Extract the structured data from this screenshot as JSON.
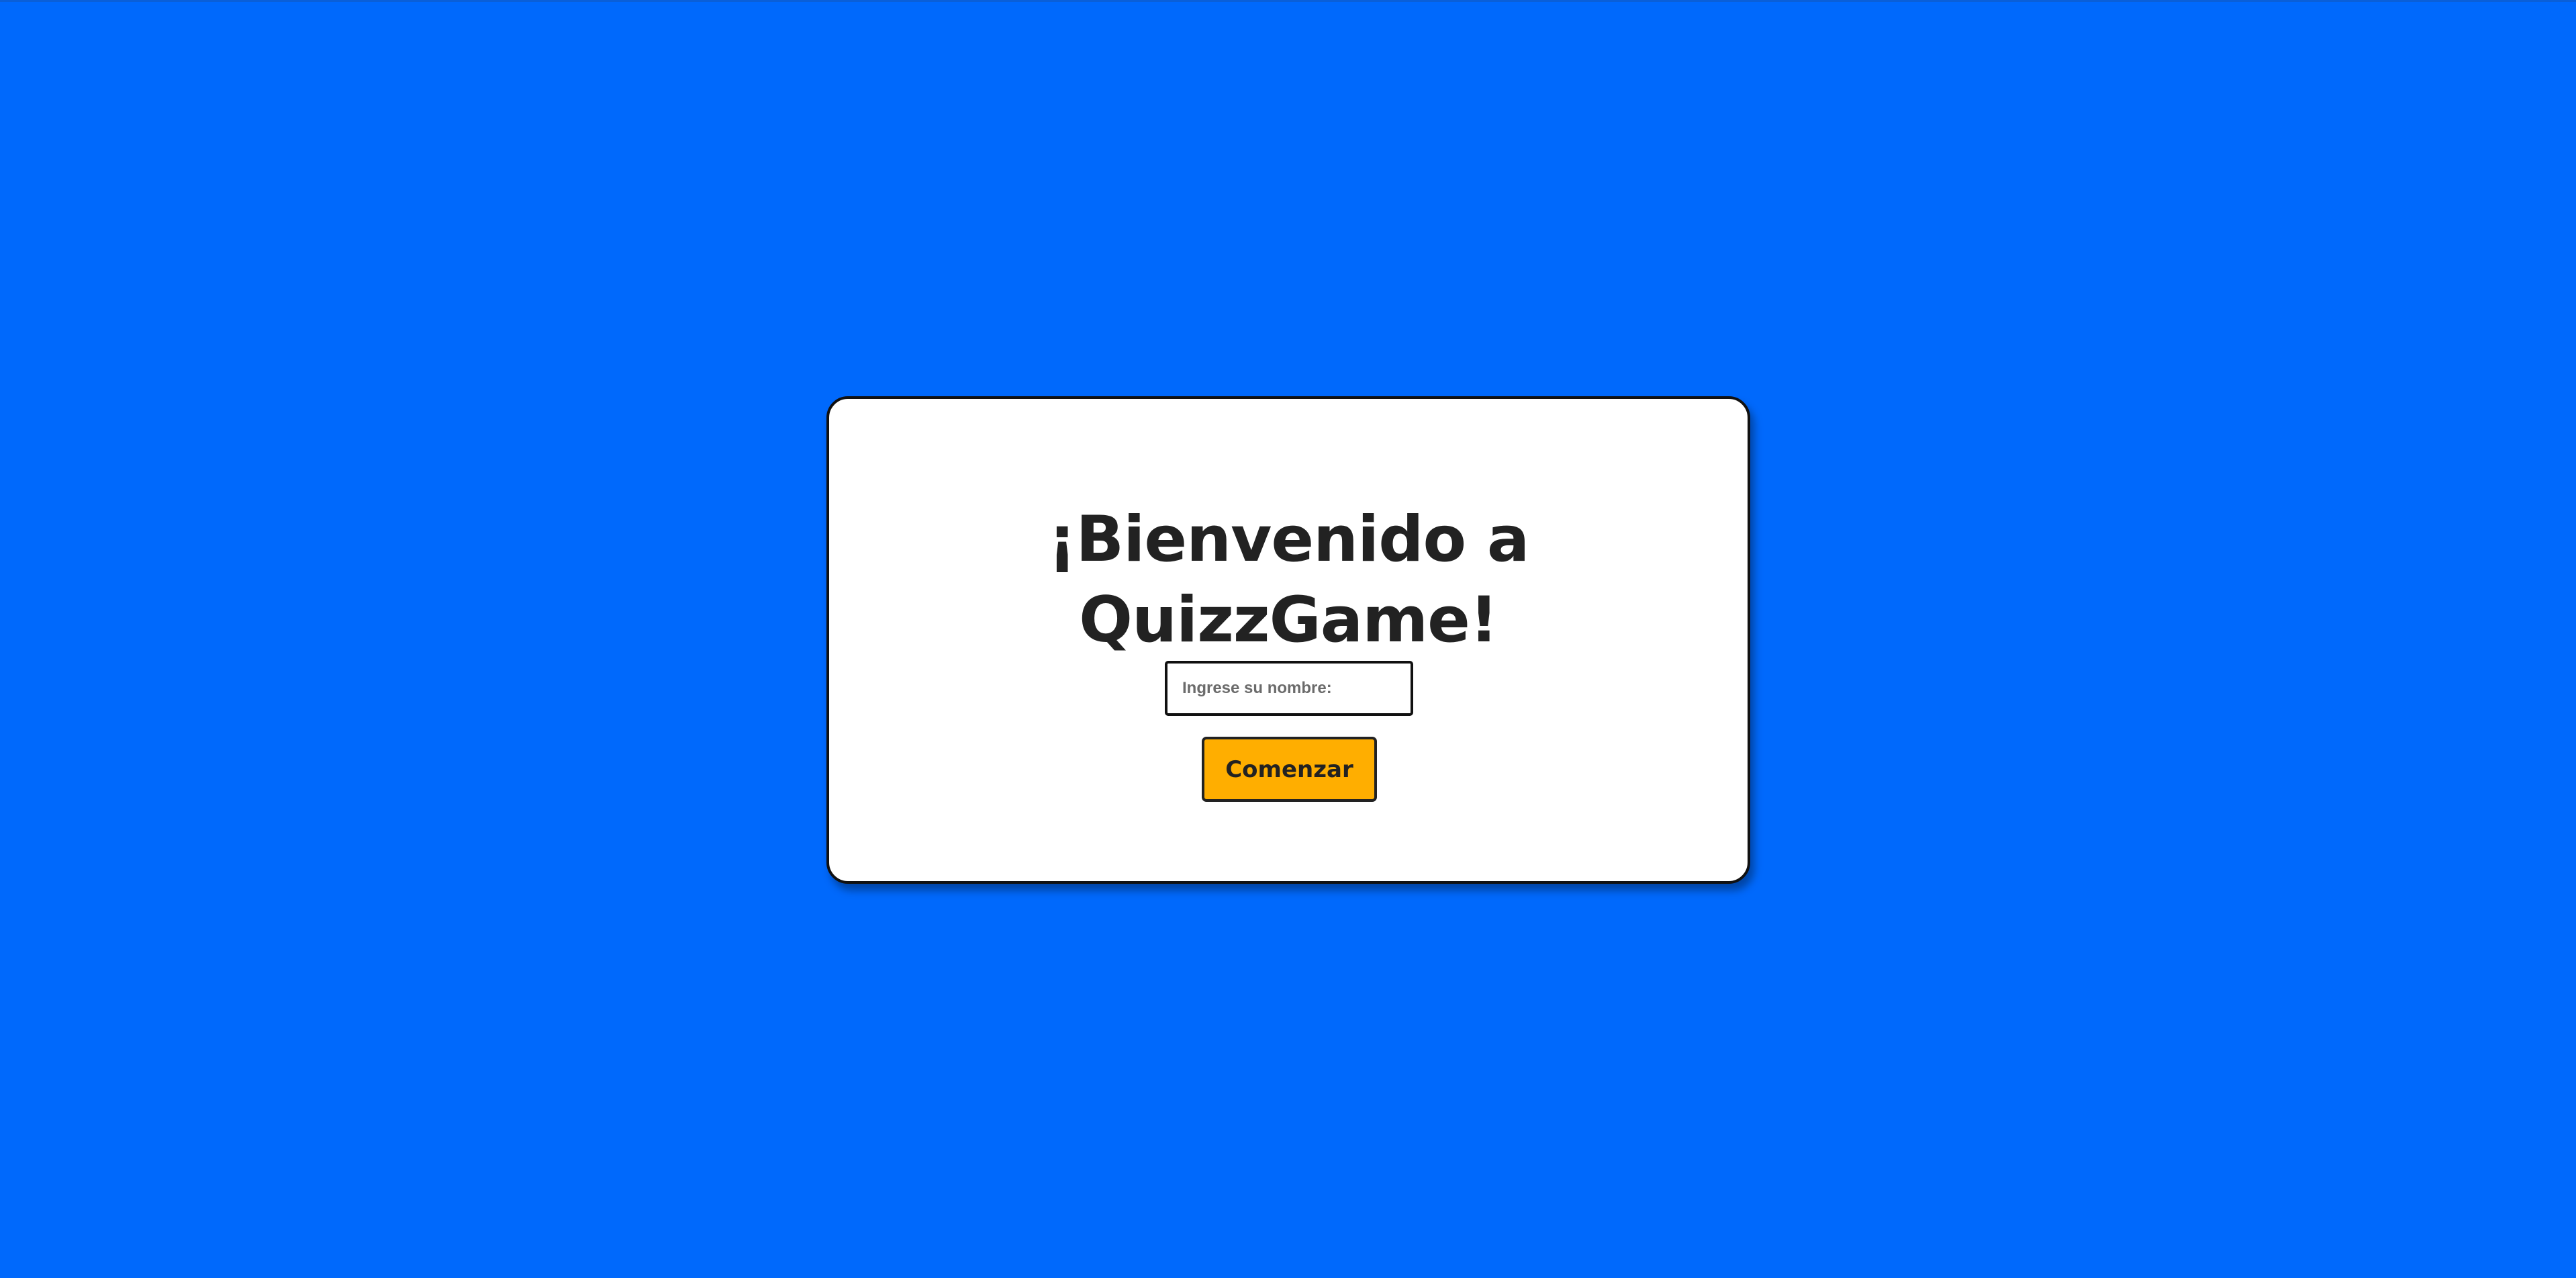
{
  "welcome": {
    "title": "¡Bienvenido a QuizzGame!",
    "name_input": {
      "placeholder": "Ingrese su nombre:",
      "value": ""
    },
    "start_button_label": "Comenzar"
  },
  "colors": {
    "background": "#0069fc",
    "card": "#ffffff",
    "button": "#ffae00",
    "text": "#222222"
  }
}
